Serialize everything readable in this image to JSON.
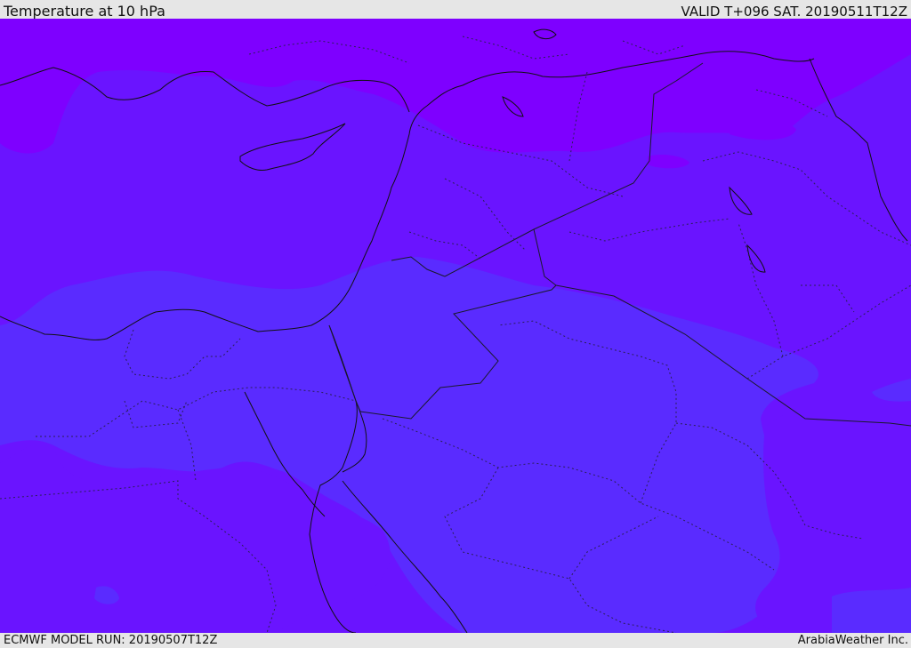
{
  "header": {
    "title": "Temperature at 10 hPa",
    "valid": "VALID T+096 SAT. 20190511T12Z"
  },
  "footer": {
    "model_run": "ECMWF MODEL RUN: 20190507T12Z",
    "credit": "ArabiaWeather Inc."
  },
  "colors": {
    "band_coldest": "#7e00ff",
    "band_mid": "#6a14ff",
    "band_warm": "#5a2bff",
    "coast_line": "#111111",
    "border_line": "#1a1a2a"
  }
}
